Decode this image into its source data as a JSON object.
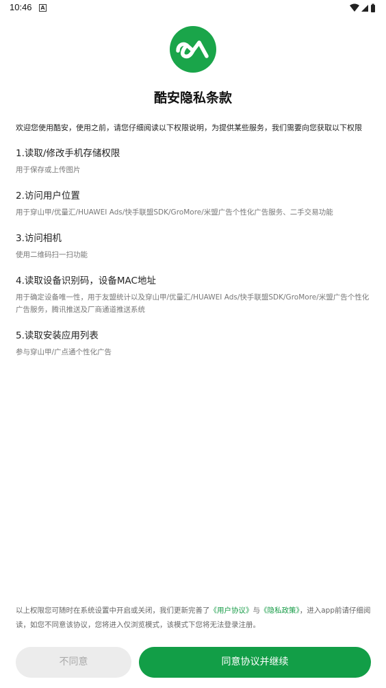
{
  "status_bar": {
    "time": "10:46",
    "notification_icon": "a-letter-icon",
    "icons": [
      "wifi-icon",
      "signal-icon",
      "battery-icon"
    ]
  },
  "logo": {
    "icon": "coolapk-logo",
    "color": "#1aa54a"
  },
  "title": "酷安隐私条款",
  "intro": "欢迎您使用酷安，使用之前，请您仔细阅读以下权限说明，为提供某些服务，我们需要向您获取以下权限",
  "sections": [
    {
      "title": "1.读取/修改手机存储权限",
      "desc": "用于保存或上传图片"
    },
    {
      "title": "2.访问用户位置",
      "desc": "用于穿山甲/优量汇/HUAWEI Ads/快手联盟SDK/GroMore/米盟广告个性化广告服务、二手交易功能"
    },
    {
      "title": "3.访问相机",
      "desc": "使用二维码扫一扫功能"
    },
    {
      "title": "4.读取设备识别码，设备MAC地址",
      "desc": "用于确定设备唯一性，用于友盟统计以及穿山甲/优量汇/HUAWEI Ads/快手联盟SDK/GroMore/米盟广告个性化广告服务，腾讯推送及厂商通道推送系统"
    },
    {
      "title": "5.读取安装应用列表",
      "desc": "参与穿山甲/广点通个性化广告"
    }
  ],
  "footer": {
    "part1": "以上权限您可随时在系统设置中开启或关闭，我们更新完善了",
    "user_agreement": "《用户协议》",
    "and": "与",
    "privacy_policy": "《隐私政策》",
    "part2": "，进入app前请仔细阅读，如您不同意该协议，您将进入仅浏览模式，该模式下您将无法登录注册。"
  },
  "buttons": {
    "disagree": "不同意",
    "agree": "同意协议并继续"
  },
  "colors": {
    "accent": "#129e47",
    "link": "#169b46",
    "disabled_bg": "#ececec"
  }
}
